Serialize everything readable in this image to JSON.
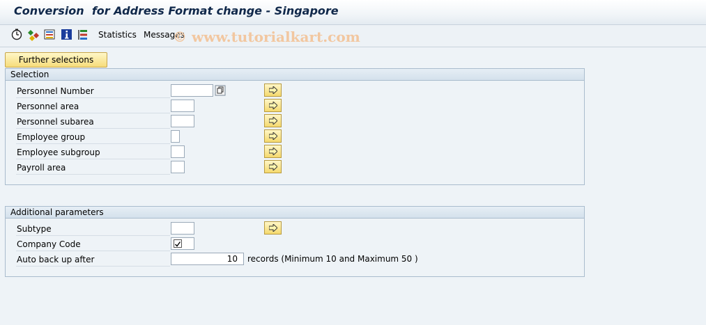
{
  "title": "Conversion  for Address Format change - Singapore",
  "toolbar": {
    "statistics": "Statistics",
    "messages": "Messages",
    "watermark": "© www.tutorialkart.com",
    "icons": [
      "execute-icon",
      "variant-icon",
      "save-variant-icon",
      "info-icon",
      "structure-icon"
    ]
  },
  "further_selections": "Further selections",
  "selection": {
    "header": "Selection",
    "rows": [
      {
        "label": "Personnel Number",
        "value": ""
      },
      {
        "label": "Personnel area",
        "value": ""
      },
      {
        "label": "Personnel subarea",
        "value": ""
      },
      {
        "label": "Employee group",
        "value": ""
      },
      {
        "label": "Employee subgroup",
        "value": ""
      },
      {
        "label": "Payroll area",
        "value": ""
      }
    ]
  },
  "additional": {
    "header": "Additional parameters",
    "subtype_label": "Subtype",
    "subtype_value": "",
    "company_code_label": "Company Code",
    "company_code_checked": true,
    "auto_backup_label": "Auto back up after",
    "auto_backup_value": "10",
    "records_note": "records (Minimum 10 and Maximum 50 )"
  },
  "colors": {
    "title_text": "#10284a",
    "button_yellow": "#f6dc7a",
    "group_border": "#a9bccd",
    "background": "#eef3f7"
  }
}
